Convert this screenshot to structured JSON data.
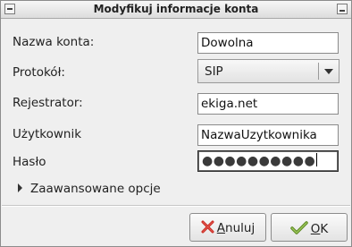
{
  "window": {
    "title": "Modyfikuj informacje konta"
  },
  "form": {
    "account_name": {
      "label": "Nazwa konta:",
      "value": "Dowolna"
    },
    "protocol": {
      "label": "Protokół:",
      "value": "SIP"
    },
    "registrar": {
      "label": "Rejestrator:",
      "value": "ekiga.net"
    },
    "user": {
      "label": "Użytkownik",
      "value": "NazwaUzytkownika"
    },
    "password": {
      "label": "Hasło",
      "value": "●●●●●●●●●●"
    }
  },
  "expander": {
    "label": "Zaawansowane opcje"
  },
  "buttons": {
    "cancel": {
      "mnemonic": "A",
      "rest": "nuluj"
    },
    "ok": {
      "mnemonic": "O",
      "rest": "K"
    }
  },
  "icons": {
    "cancel": "red-x-icon",
    "ok": "green-check-icon",
    "accent_red": "#c8271f",
    "accent_green": "#7fa83e"
  }
}
